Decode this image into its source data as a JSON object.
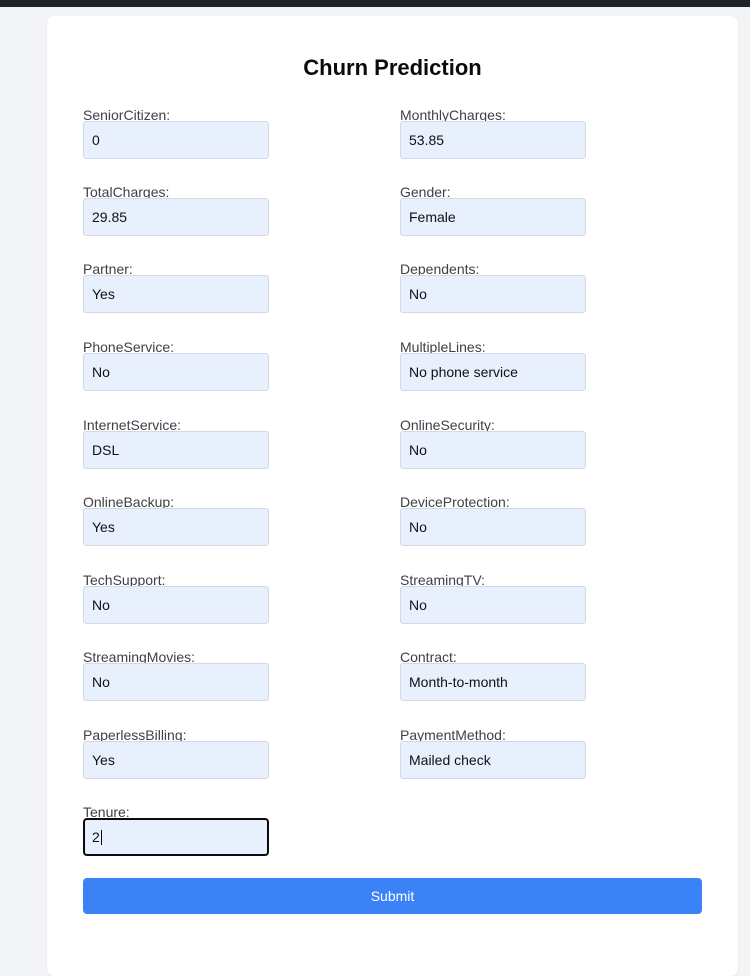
{
  "form": {
    "title": "Churn Prediction",
    "fields": [
      {
        "label": "SeniorCitizen:",
        "value": "0"
      },
      {
        "label": "MonthlyCharges:",
        "value": "53.85"
      },
      {
        "label": "TotalCharges:",
        "value": "29.85"
      },
      {
        "label": "Gender:",
        "value": "Female"
      },
      {
        "label": "Partner:",
        "value": "Yes"
      },
      {
        "label": "Dependents:",
        "value": "No"
      },
      {
        "label": "PhoneService:",
        "value": "No"
      },
      {
        "label": "MultipleLines:",
        "value": "No phone service"
      },
      {
        "label": "InternetService:",
        "value": "DSL"
      },
      {
        "label": "OnlineSecurity:",
        "value": "No"
      },
      {
        "label": "OnlineBackup:",
        "value": "Yes"
      },
      {
        "label": "DeviceProtection:",
        "value": "No"
      },
      {
        "label": "TechSupport:",
        "value": "No"
      },
      {
        "label": "StreamingTV:",
        "value": "No"
      },
      {
        "label": "StreamingMovies:",
        "value": "No"
      },
      {
        "label": "Contract:",
        "value": "Month-to-month"
      },
      {
        "label": "PaperlessBilling:",
        "value": "Yes"
      },
      {
        "label": "PaymentMethod:",
        "value": "Mailed check"
      },
      {
        "label": "Tenure:",
        "value": "2"
      }
    ],
    "submit_label": "Submit"
  },
  "colors": {
    "input_background": "#e8effd",
    "submit_background": "#3b82f6",
    "page_background": "#f3f4f6"
  }
}
